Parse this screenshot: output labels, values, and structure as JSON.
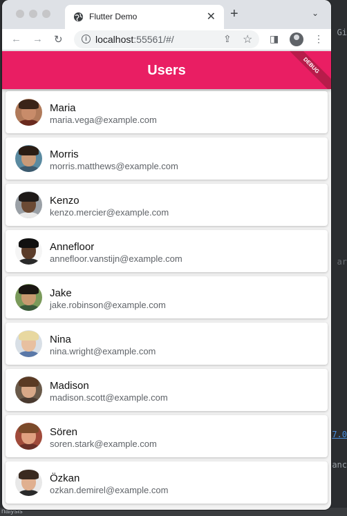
{
  "browser": {
    "tab_title": "Flutter Demo",
    "url_host": "localhost",
    "url_rest": ":55561/#/"
  },
  "app": {
    "title": "Users",
    "debug_label": "DEBUG",
    "accent_color": "#e91e63"
  },
  "users": [
    {
      "name": "Maria",
      "email": "maria.vega@example.com"
    },
    {
      "name": "Morris",
      "email": "morris.matthews@example.com"
    },
    {
      "name": "Kenzo",
      "email": "kenzo.mercier@example.com"
    },
    {
      "name": "Annefloor",
      "email": "annefloor.vanstijn@example.com"
    },
    {
      "name": "Jake",
      "email": "jake.robinson@example.com"
    },
    {
      "name": "Nina",
      "email": "nina.wright@example.com"
    },
    {
      "name": "Madison",
      "email": "madison.scott@example.com"
    },
    {
      "name": "Sören",
      "email": "soren.stark@example.com"
    },
    {
      "name": "Özkan",
      "email": "ozkan.demirel@example.com"
    }
  ],
  "background_ide": {
    "right_text_1": "Gi",
    "right_text_2": "ar",
    "right_text_3": "7.0",
    "right_text_4": "anc",
    "bottom_text": "nalysis"
  }
}
